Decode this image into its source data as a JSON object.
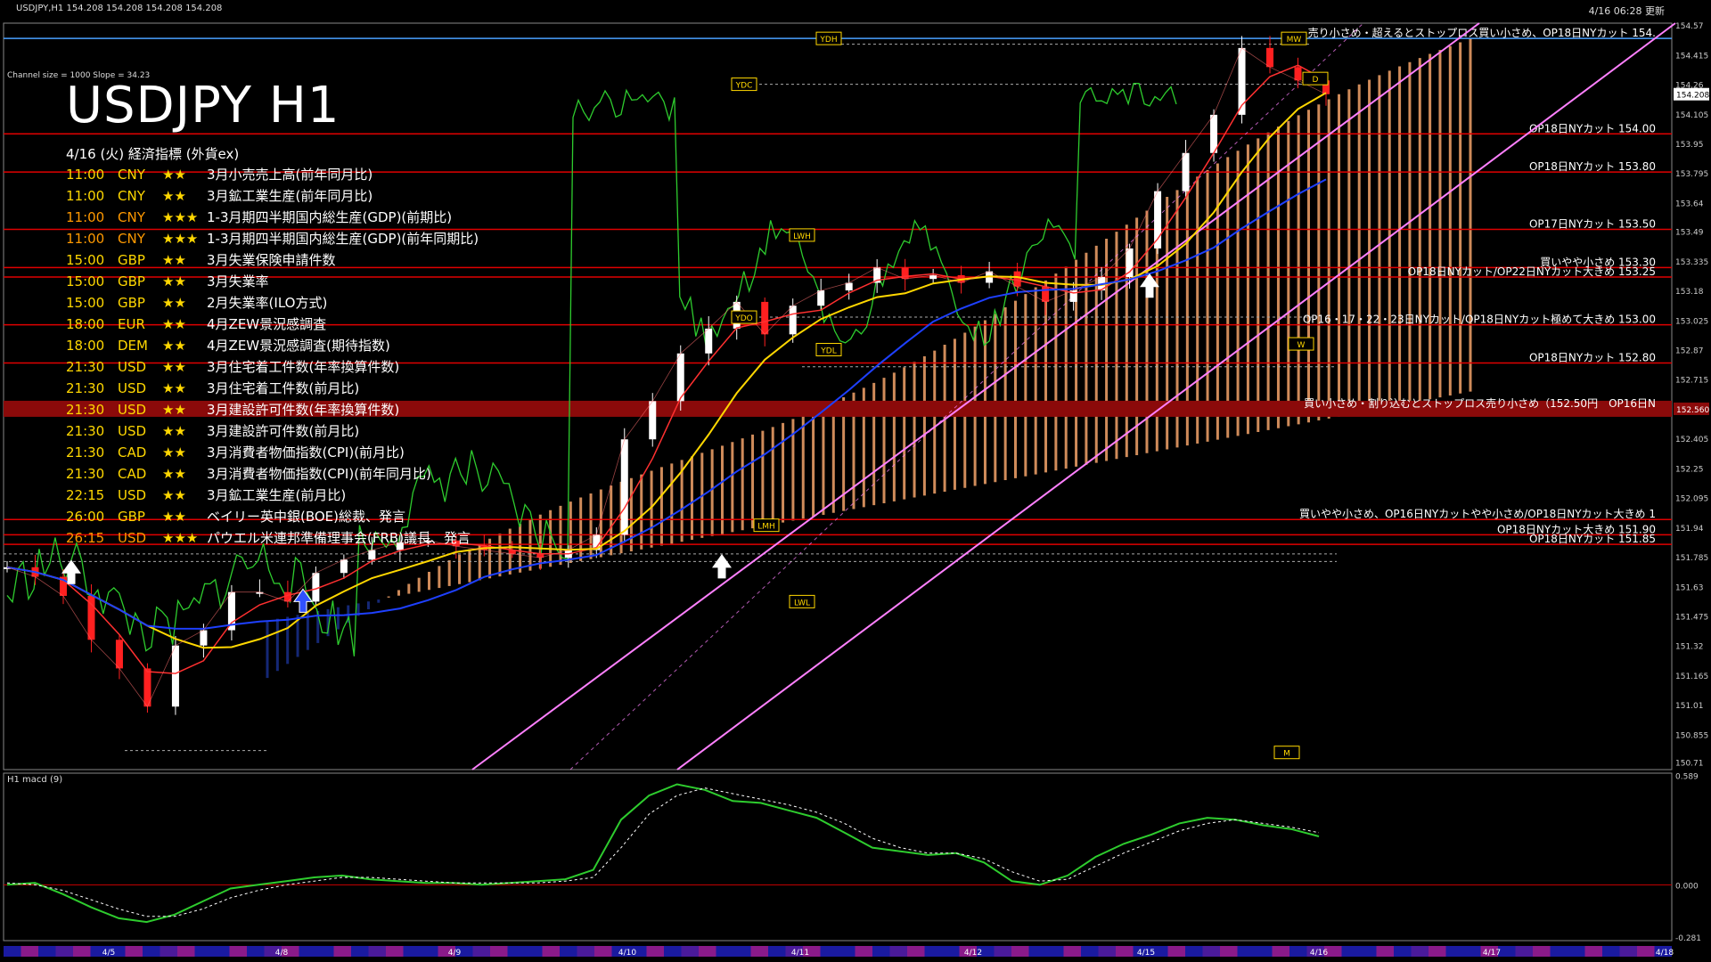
{
  "header": {
    "symbol_line": "USDJPY,H1  154.208 154.208 154.208 154.208",
    "channel_info": "Channel size = 1000 Slope = 34.23",
    "title": "USDJPY H1",
    "updated": "4/16 06:28 更新"
  },
  "econ": {
    "heading": "4/16 (火) 経済指標 (外貨ex)",
    "events": [
      {
        "time": "11:00",
        "cur": "CNY",
        "stars": "★★",
        "name": "3月小売売上高(前年同月比)",
        "color": "#ffd700"
      },
      {
        "time": "11:00",
        "cur": "CNY",
        "stars": "★★",
        "name": "3月鉱工業生産(前年同月比)",
        "color": "#ffd700"
      },
      {
        "time": "11:00",
        "cur": "CNY",
        "stars": "★★★",
        "name": "1-3月期四半期国内総生産(GDP)(前期比)",
        "color": "#ff9900"
      },
      {
        "time": "11:00",
        "cur": "CNY",
        "stars": "★★★",
        "name": "1-3月期四半期国内総生産(GDP)(前年同期比)",
        "color": "#ff9900"
      },
      {
        "time": "15:00",
        "cur": "GBP",
        "stars": "★★",
        "name": "3月失業保険申請件数",
        "color": "#ffd700"
      },
      {
        "time": "15:00",
        "cur": "GBP",
        "stars": "★★",
        "name": "3月失業率",
        "color": "#ffd700"
      },
      {
        "time": "15:00",
        "cur": "GBP",
        "stars": "★★",
        "name": "2月失業率(ILO方式)",
        "color": "#ffd700"
      },
      {
        "time": "18:00",
        "cur": "EUR",
        "stars": "★★",
        "name": "4月ZEW景況感調査",
        "color": "#ffd700"
      },
      {
        "time": "18:00",
        "cur": "DEM",
        "stars": "★★",
        "name": "4月ZEW景況感調査(期待指数)",
        "color": "#ffd700"
      },
      {
        "time": "21:30",
        "cur": "USD",
        "stars": "★★",
        "name": "3月住宅着工件数(年率換算件数)",
        "color": "#ffd700"
      },
      {
        "time": "21:30",
        "cur": "USD",
        "stars": "★★",
        "name": "3月住宅着工件数(前月比)",
        "color": "#ffd700"
      },
      {
        "time": "21:30",
        "cur": "USD",
        "stars": "★★",
        "name": "3月建設許可件数(年率換算件数)",
        "color": "#ffd700"
      },
      {
        "time": "21:30",
        "cur": "USD",
        "stars": "★★",
        "name": "3月建設許可件数(前月比)",
        "color": "#ffd700"
      },
      {
        "time": "21:30",
        "cur": "CAD",
        "stars": "★★",
        "name": "3月消費者物価指数(CPI)(前月比)",
        "color": "#ffd700"
      },
      {
        "time": "21:30",
        "cur": "CAD",
        "stars": "★★",
        "name": "3月消費者物価指数(CPI)(前年同月比)",
        "color": "#ffd700"
      },
      {
        "time": "22:15",
        "cur": "USD",
        "stars": "★★",
        "name": "3月鉱工業生産(前月比)",
        "color": "#ffd700"
      },
      {
        "time": "26:00",
        "cur": "GBP",
        "stars": "★★",
        "name": "ベイリー英中銀(BOE)総裁、発言",
        "color": "#ffd700"
      },
      {
        "time": "26:15",
        "cur": "USD",
        "stars": "★★★",
        "name": "パウエル米連邦準備理事会(FRB)議長、発言",
        "color": "#ff9900"
      }
    ]
  },
  "colors": {
    "background": "#000000",
    "candle_up": "#ffffff",
    "candle_down": "#ff2020",
    "ichimoku_cloud": "#f4a46a",
    "ichimoku_cloud_dn": "#1e3aa8",
    "channel": "#ff80ff",
    "green_osc": "#2ecc2e",
    "yellow_ma": "#ffd700",
    "blue_ma": "#1e40ff",
    "level_line": "#e00000"
  },
  "chart_data": [
    {
      "type": "line",
      "title": "USDJPY H1",
      "y_axis_ticks": [
        154.57,
        154.415,
        154.26,
        154.105,
        153.95,
        153.795,
        153.64,
        153.49,
        153.335,
        153.18,
        153.025,
        152.87,
        152.715,
        152.56,
        152.405,
        152.25,
        152.095,
        151.94,
        151.785,
        151.63,
        151.475,
        151.32,
        151.165,
        151.01,
        150.855,
        150.71
      ],
      "ylim": [
        150.67,
        154.58
      ],
      "x_ticks": [
        "4/5",
        "4/8",
        "4/9",
        "4/10",
        "4/11",
        "4/12",
        "4/15",
        "4/16",
        "4/17",
        "4/18"
      ],
      "current_price": 154.208,
      "current_price_label": "154.208",
      "highlight_price_label": "152.560",
      "series": [
        {
          "name": "USDJPY close",
          "x": [
            "4/4 21:00",
            "4/5 00:00",
            "4/5 03:00",
            "4/5 06:00",
            "4/5 09:00",
            "4/5 12:00",
            "4/5 15:00",
            "4/5 18:00",
            "4/5 21:00",
            "4/8 00:00",
            "4/8 06:00",
            "4/8 12:00",
            "4/8 18:00",
            "4/9 00:00",
            "4/9 06:00",
            "4/9 12:00",
            "4/9 18:00",
            "4/10 00:00",
            "4/10 06:00",
            "4/10 12:00",
            "4/10 18:00",
            "4/10 21:00",
            "4/10 21:30",
            "4/10 22:00",
            "4/11 00:00",
            "4/11 03:00",
            "4/11 06:00",
            "4/11 09:00",
            "4/11 12:00",
            "4/11 15:00",
            "4/11 18:00",
            "4/11 21:00",
            "4/12 00:00",
            "4/12 06:00",
            "4/12 12:00",
            "4/12 18:00",
            "4/12 21:00",
            "4/15 00:00",
            "4/15 06:00",
            "4/15 12:00",
            "4/15 15:00",
            "4/15 18:00",
            "4/15 21:00",
            "4/15 23:00",
            "4/16 00:00",
            "4/16 02:00",
            "4/16 04:00",
            "4/16 06:00"
          ],
          "values": [
            151.73,
            151.68,
            151.58,
            151.35,
            151.2,
            151.0,
            151.32,
            151.4,
            151.6,
            151.6,
            151.55,
            151.7,
            151.77,
            151.82,
            151.86,
            151.87,
            151.84,
            151.82,
            151.8,
            151.78,
            151.82,
            151.9,
            152.4,
            152.6,
            152.85,
            152.98,
            153.12,
            152.95,
            153.1,
            153.18,
            153.22,
            153.3,
            153.24,
            153.26,
            153.22,
            153.28,
            153.2,
            153.12,
            153.18,
            153.25,
            153.4,
            153.7,
            153.9,
            154.1,
            154.45,
            154.35,
            154.28,
            154.208
          ]
        }
      ],
      "levels": [
        {
          "price": 154.5,
          "label": "売り小さめ・超えるとストップロス買い小さめ、OP18日NYカット 154.",
          "style": "blue"
        },
        {
          "price": 154.0,
          "label": "OP18日NYカット 154.00",
          "style": "red"
        },
        {
          "price": 153.8,
          "label": "OP18日NYカット 153.80",
          "style": "red"
        },
        {
          "price": 153.5,
          "label": "OP17日NYカット 153.50",
          "style": "red"
        },
        {
          "price": 153.3,
          "label": "買いやや小さめ 153.30",
          "style": "red"
        },
        {
          "price": 153.25,
          "label": "OP18日NYカット/OP22日NYカット大きめ 153.25",
          "style": "red"
        },
        {
          "price": 153.0,
          "label": "OP16・17・22・23日NYカット/OP18日NYカット極めて大きめ 153.00",
          "style": "red"
        },
        {
          "price": 152.8,
          "label": "OP18日NYカット 152.80",
          "style": "red"
        },
        {
          "price": 152.56,
          "label": "買い小さめ・割り込むとストップロス売り小さめ（152.50円　OP16日N",
          "style": "band"
        },
        {
          "price": 151.98,
          "label": "買いやや小さめ、OP16日NYカットやや小さめ/OP18日NYカット大きめ 1",
          "style": "red"
        },
        {
          "price": 151.9,
          "label": "OP18日NYカット大きめ 151.90",
          "style": "red"
        },
        {
          "price": 151.85,
          "label": "OP18日NYカット 151.85",
          "style": "red"
        }
      ],
      "markers": [
        "YDH",
        "YDC",
        "YDO",
        "YDL",
        "LWH",
        "LWL",
        "LMH",
        "MW",
        "D",
        "W",
        "M"
      ]
    },
    {
      "type": "line",
      "title": "H1 macd (9)",
      "y_axis_ticks": [
        0.589,
        0.0,
        -0.281
      ],
      "ylim": [
        -0.3,
        0.6
      ],
      "series": [
        {
          "name": "macd",
          "values": [
            0.0,
            0.01,
            -0.05,
            -0.12,
            -0.18,
            -0.2,
            -0.16,
            -0.09,
            -0.02,
            0.0,
            0.02,
            0.04,
            0.05,
            0.03,
            0.02,
            0.01,
            0.01,
            0.0,
            0.01,
            0.02,
            0.03,
            0.08,
            0.35,
            0.48,
            0.54,
            0.51,
            0.45,
            0.44,
            0.4,
            0.36,
            0.28,
            0.2,
            0.18,
            0.16,
            0.17,
            0.12,
            0.02,
            0.0,
            0.05,
            0.15,
            0.22,
            0.27,
            0.33,
            0.36,
            0.35,
            0.32,
            0.3,
            0.26
          ]
        },
        {
          "name": "signal",
          "values": [
            0.01,
            0.0,
            -0.03,
            -0.08,
            -0.13,
            -0.17,
            -0.17,
            -0.13,
            -0.07,
            -0.03,
            0.0,
            0.02,
            0.04,
            0.04,
            0.03,
            0.02,
            0.01,
            0.01,
            0.01,
            0.01,
            0.02,
            0.04,
            0.2,
            0.38,
            0.48,
            0.52,
            0.49,
            0.46,
            0.43,
            0.39,
            0.33,
            0.25,
            0.2,
            0.17,
            0.17,
            0.14,
            0.07,
            0.02,
            0.03,
            0.1,
            0.17,
            0.23,
            0.29,
            0.33,
            0.35,
            0.33,
            0.31,
            0.28
          ]
        }
      ]
    }
  ]
}
